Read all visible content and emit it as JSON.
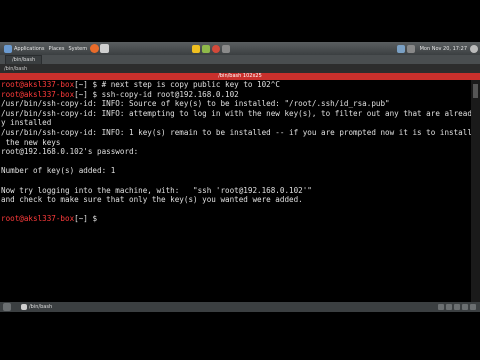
{
  "panel": {
    "applications": "Applications",
    "places": "Places",
    "system": "System",
    "clock": "Mon Nov 20, 17:27"
  },
  "taskbar": {
    "task": "/bin/bash"
  },
  "pathbar": {
    "path": "/bin/bash"
  },
  "window": {
    "title": "/bin/bash 102x25"
  },
  "terminal": {
    "prompt": "root@aksl337-box",
    "prompt_dir": "~",
    "lines": [
      {
        "prompt": true,
        "cmd": "# next step is copy public key to 102^C"
      },
      {
        "prompt": true,
        "cmd": "ssh-copy-id root@192.168.0.102"
      },
      {
        "text": "/usr/bin/ssh-copy-id: INFO: Source of key(s) to be installed: \"/root/.ssh/id_rsa.pub\""
      },
      {
        "text": "/usr/bin/ssh-copy-id: INFO: attempting to log in with the new key(s), to filter out any that are alread"
      },
      {
        "text": "y installed"
      },
      {
        "text": "/usr/bin/ssh-copy-id: INFO: 1 key(s) remain to be installed -- if you are prompted now it is to install"
      },
      {
        "text": " the new keys"
      },
      {
        "text": "root@192.168.0.102's password:"
      },
      {
        "text": ""
      },
      {
        "text": "Number of key(s) added: 1"
      },
      {
        "text": ""
      },
      {
        "text": "Now try logging into the machine, with:   \"ssh 'root@192.168.0.102'\""
      },
      {
        "text": "and check to make sure that only the key(s) you wanted were added."
      },
      {
        "text": ""
      },
      {
        "prompt": true,
        "cmd": ""
      }
    ]
  },
  "bottom": {
    "task": "/bin/bash"
  },
  "colors": {
    "prompt": "#ff3b3b",
    "titlebar": "#c9302c"
  }
}
